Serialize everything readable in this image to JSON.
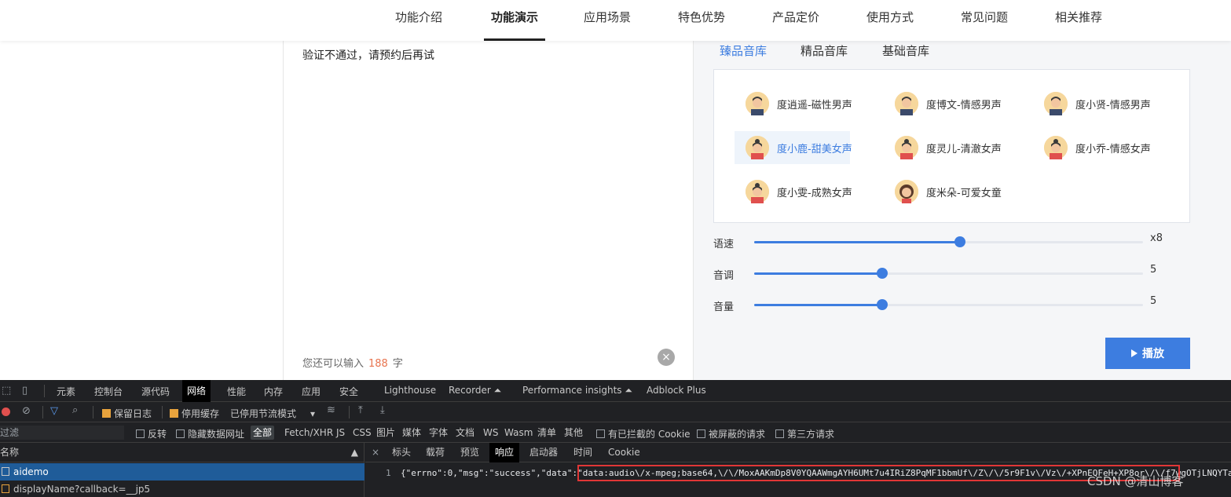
{
  "nav": {
    "items": [
      "功能介绍",
      "功能演示",
      "应用场景",
      "特色优势",
      "产品定价",
      "使用方式",
      "常见问题",
      "相关推荐"
    ],
    "active_index": 1
  },
  "editor": {
    "text": "验证不通过，请预约后再试",
    "hint_prefix": "您还可以输入",
    "remaining": "188",
    "hint_suffix": "字",
    "clear_icon": "×"
  },
  "voice_tabs": [
    "臻品音库",
    "精品音库",
    "基础音库"
  ],
  "voices": [
    {
      "name": "度逍遥-磁性男声",
      "gender": "male",
      "selected": false
    },
    {
      "name": "度博文-情感男声",
      "gender": "male",
      "selected": false
    },
    {
      "name": "度小贤-情感男声",
      "gender": "male",
      "selected": false
    },
    {
      "name": "度小鹿-甜美女声",
      "gender": "female",
      "selected": true
    },
    {
      "name": "度灵儿-清澈女声",
      "gender": "female",
      "selected": false
    },
    {
      "name": "度小乔-情感女声",
      "gender": "female",
      "selected": false
    },
    {
      "name": "度小雯-成熟女声",
      "gender": "female",
      "selected": false
    },
    {
      "name": "度米朵-可爱女童",
      "gender": "child",
      "selected": false
    }
  ],
  "sliders": [
    {
      "label": "语速",
      "value_text": "x8",
      "fraction": 0.53
    },
    {
      "label": "音调",
      "value_text": "5",
      "fraction": 0.33
    },
    {
      "label": "音量",
      "value_text": "5",
      "fraction": 0.33
    }
  ],
  "play_button": "播放",
  "colors": {
    "accent": "#3d7de0",
    "count": "#e8744f",
    "devtools_bg": "#202124",
    "highlight": "#e03636"
  },
  "devtools": {
    "tabs": [
      "元素",
      "控制台",
      "源代码",
      "网络",
      "性能",
      "内存",
      "应用",
      "安全",
      "Lighthouse",
      "Recorder ⏶",
      "Performance insights ⏶",
      "Adblock Plus"
    ],
    "active_tab": "网络",
    "toolbar": {
      "preserve_log": "保留日志",
      "disable_cache": "停用缓存",
      "throttle": "已停用节流模式"
    },
    "filter": {
      "placeholder": "过滤",
      "invert": "反转",
      "hide_data_urls": "隐藏数据网址",
      "types": [
        "全部",
        "Fetch/XHR",
        "JS",
        "CSS",
        "图片",
        "媒体",
        "字体",
        "文档",
        "WS",
        "Wasm",
        "清单",
        "其他"
      ],
      "blocked_cookies": "有已拦截的 Cookie",
      "blocked_requests": "被屏蔽的请求",
      "third_party": "第三方请求"
    },
    "name_header": "名称",
    "requests": [
      "aidemo",
      "displayName?callback=__jp5"
    ],
    "response_tabs": [
      "标头",
      "载荷",
      "预览",
      "响应",
      "启动器",
      "时间",
      "Cookie"
    ],
    "active_response_tab": "响应",
    "line_number": "1",
    "response_text": "{\"errno\":0,\"msg\":\"success\",\"data\":\"data:audio\\/x-mpeg;base64,\\/\\/MoxAAKmDp8V0YQAAWmgAYH6UMt7u4IRiZ8PqMF1bbmUf\\/Z\\/\\/5r9F1v\\/Vz\\/+XPnEQFeH+XP8or\\/\\/f7wgOTjLNQYTa"
  },
  "watermark": "CSDN @清山博客"
}
